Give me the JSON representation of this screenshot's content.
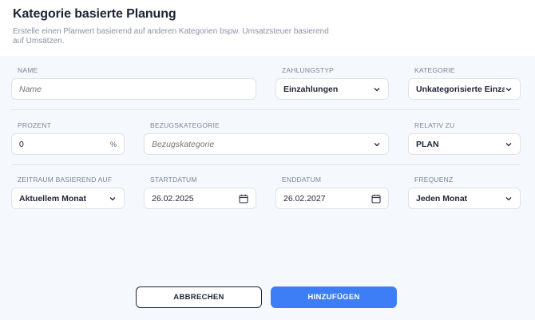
{
  "header": {
    "title": "Kategorie basierte Planung",
    "subtitle": "Erstelle einen Planwert basierend auf anderen Kategorien bspw. Umsatzsteuer basierend auf Umsätzen."
  },
  "form": {
    "name": {
      "label": "NAME",
      "placeholder": "Name"
    },
    "zahlungstyp": {
      "label": "ZAHLUNGSTYP",
      "value": "Einzahlungen"
    },
    "kategorie": {
      "label": "KATEGORIE",
      "value": "Unkategorisierte Einza..."
    },
    "prozent": {
      "label": "PROZENT",
      "value": "0",
      "suffix": "%"
    },
    "bezugskategorie": {
      "label": "BEZUGSKATEGORIE",
      "placeholder": "Bezugskategorie"
    },
    "relativ_zu": {
      "label": "RELATIV ZU",
      "value": "PLAN"
    },
    "zeitraum": {
      "label": "ZEITRAUM BASIEREND AUF",
      "value": "Aktuellem Monat"
    },
    "startdatum": {
      "label": "STARTDATUM",
      "value": "26.02.2025"
    },
    "enddatum": {
      "label": "ENDDATUM",
      "value": "26.02.2027"
    },
    "frequenz": {
      "label": "FREQUENZ",
      "value": "Jeden Monat"
    }
  },
  "actions": {
    "cancel_label": "ABBRECHEN",
    "add_label": "HINZUFÜGEN"
  },
  "colors": {
    "primary": "#3d7ef7",
    "background": "#f5f8fc",
    "text": "#1f2537"
  }
}
